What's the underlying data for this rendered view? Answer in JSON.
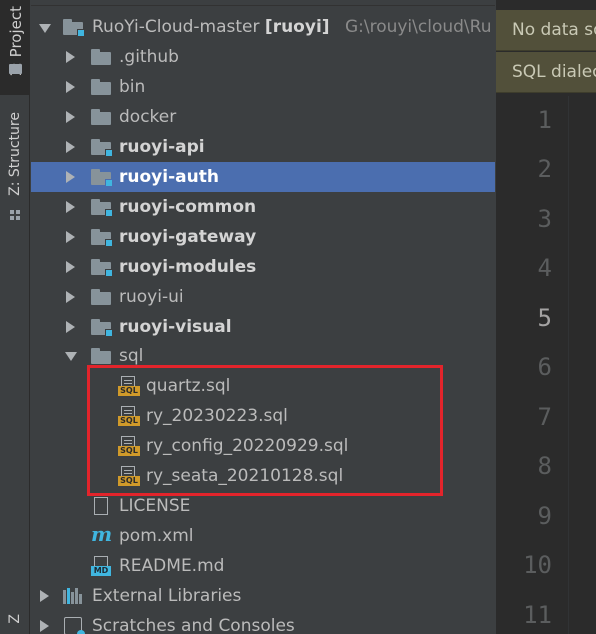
{
  "sidebar_strip": {
    "project_tab": "1: Project",
    "structure_tab": "Z: Structure",
    "bottom_tab": "Z"
  },
  "tree": {
    "root": {
      "name": "RuoYi-Cloud-master",
      "module": "[ruoyi]",
      "path": "G:\\rouyi\\cloud\\Ru"
    },
    "items": [
      {
        "label": ".github"
      },
      {
        "label": "bin"
      },
      {
        "label": "docker"
      },
      {
        "label": "ruoyi-api"
      },
      {
        "label": "ruoyi-auth"
      },
      {
        "label": "ruoyi-common"
      },
      {
        "label": "ruoyi-gateway"
      },
      {
        "label": "ruoyi-modules"
      },
      {
        "label": "ruoyi-ui"
      },
      {
        "label": "ruoyi-visual"
      },
      {
        "label": "sql"
      }
    ],
    "sql_files": [
      {
        "label": "quartz.sql"
      },
      {
        "label": "ry_20230223.sql"
      },
      {
        "label": "ry_config_20220929.sql"
      },
      {
        "label": "ry_seata_20210128.sql"
      }
    ],
    "files": [
      {
        "label": "LICENSE"
      },
      {
        "label": "pom.xml"
      },
      {
        "label": "README.md"
      }
    ],
    "external_libraries": "External Libraries",
    "scratches": "Scratches and Consoles",
    "sql_badge": "SQL",
    "md_badge": "MD",
    "pom_glyph": "m"
  },
  "editor": {
    "banner_1": "No data sources configured",
    "banner_2": "SQL dialect is not configured",
    "line_numbers": [
      "1",
      "2",
      "3",
      "4",
      "5",
      "6",
      "7",
      "8",
      "9",
      "10",
      "11"
    ],
    "current_line": "5"
  },
  "colors": {
    "selection": "#4b6eaf",
    "highlight_border": "#e3242b",
    "module_badge": "#40b6e0",
    "banner_bg": "#52503a"
  }
}
